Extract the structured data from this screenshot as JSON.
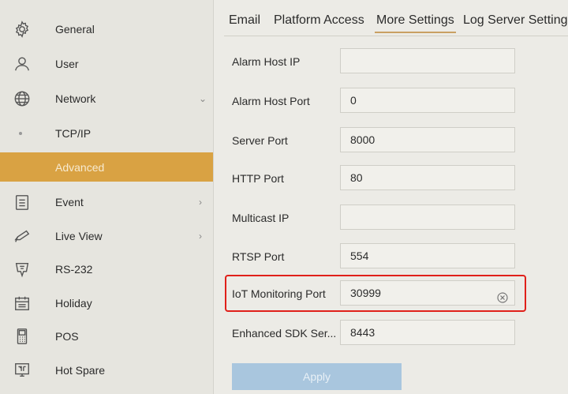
{
  "sidebar": {
    "items": [
      {
        "label": "General",
        "icon": "gear-icon"
      },
      {
        "label": "User",
        "icon": "user-icon"
      },
      {
        "label": "Network",
        "icon": "globe-icon"
      },
      {
        "label": "TCP/IP",
        "icon": "dot-icon"
      },
      {
        "label": "Advanced",
        "icon": ""
      },
      {
        "label": "Event",
        "icon": "clipboard-icon"
      },
      {
        "label": "Live View",
        "icon": "camera-icon"
      },
      {
        "label": "RS-232",
        "icon": "serial-port-icon"
      },
      {
        "label": "Holiday",
        "icon": "calendar-icon"
      },
      {
        "label": "POS",
        "icon": "pos-terminal-icon"
      },
      {
        "label": "Hot Spare",
        "icon": "hot-spare-icon"
      }
    ],
    "active_item": "Advanced",
    "accent_color": "#d9a243"
  },
  "tabs": [
    {
      "label": "Email"
    },
    {
      "label": "Platform Access"
    },
    {
      "label": "More Settings"
    },
    {
      "label": "Log Server Settings"
    }
  ],
  "active_tab": "More Settings",
  "form": {
    "fields": [
      {
        "label": "Alarm Host IP",
        "value": ""
      },
      {
        "label": "Alarm Host Port",
        "value": "0"
      },
      {
        "label": "Server Port",
        "value": "8000"
      },
      {
        "label": "HTTP Port",
        "value": "80"
      },
      {
        "label": "Multicast IP",
        "value": ""
      },
      {
        "label": "RTSP Port",
        "value": "554"
      },
      {
        "label": "IoT Monitoring Port",
        "value": "30999"
      },
      {
        "label": "Enhanced SDK Ser...",
        "value": "8443"
      }
    ],
    "highlight_color": "#e0201a"
  },
  "apply_label": "Apply"
}
